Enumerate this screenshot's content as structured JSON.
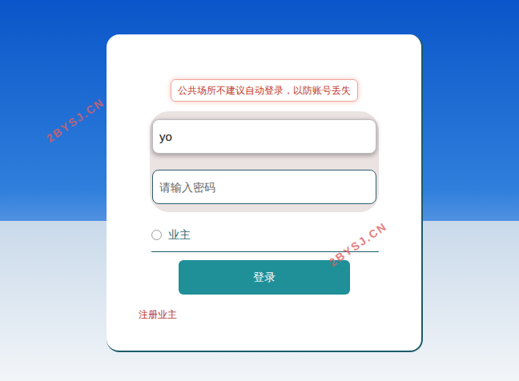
{
  "notice": "公共场所不建议自动登录，以防账号丢失",
  "username": {
    "value": "yo",
    "focused": true
  },
  "password": {
    "placeholder": "请输入密码",
    "value": ""
  },
  "role_options": [
    {
      "label": "业主",
      "selected": false
    }
  ],
  "login_button": "登录",
  "register_link": "注册业主",
  "watermark": "2BYSJ.CN"
}
